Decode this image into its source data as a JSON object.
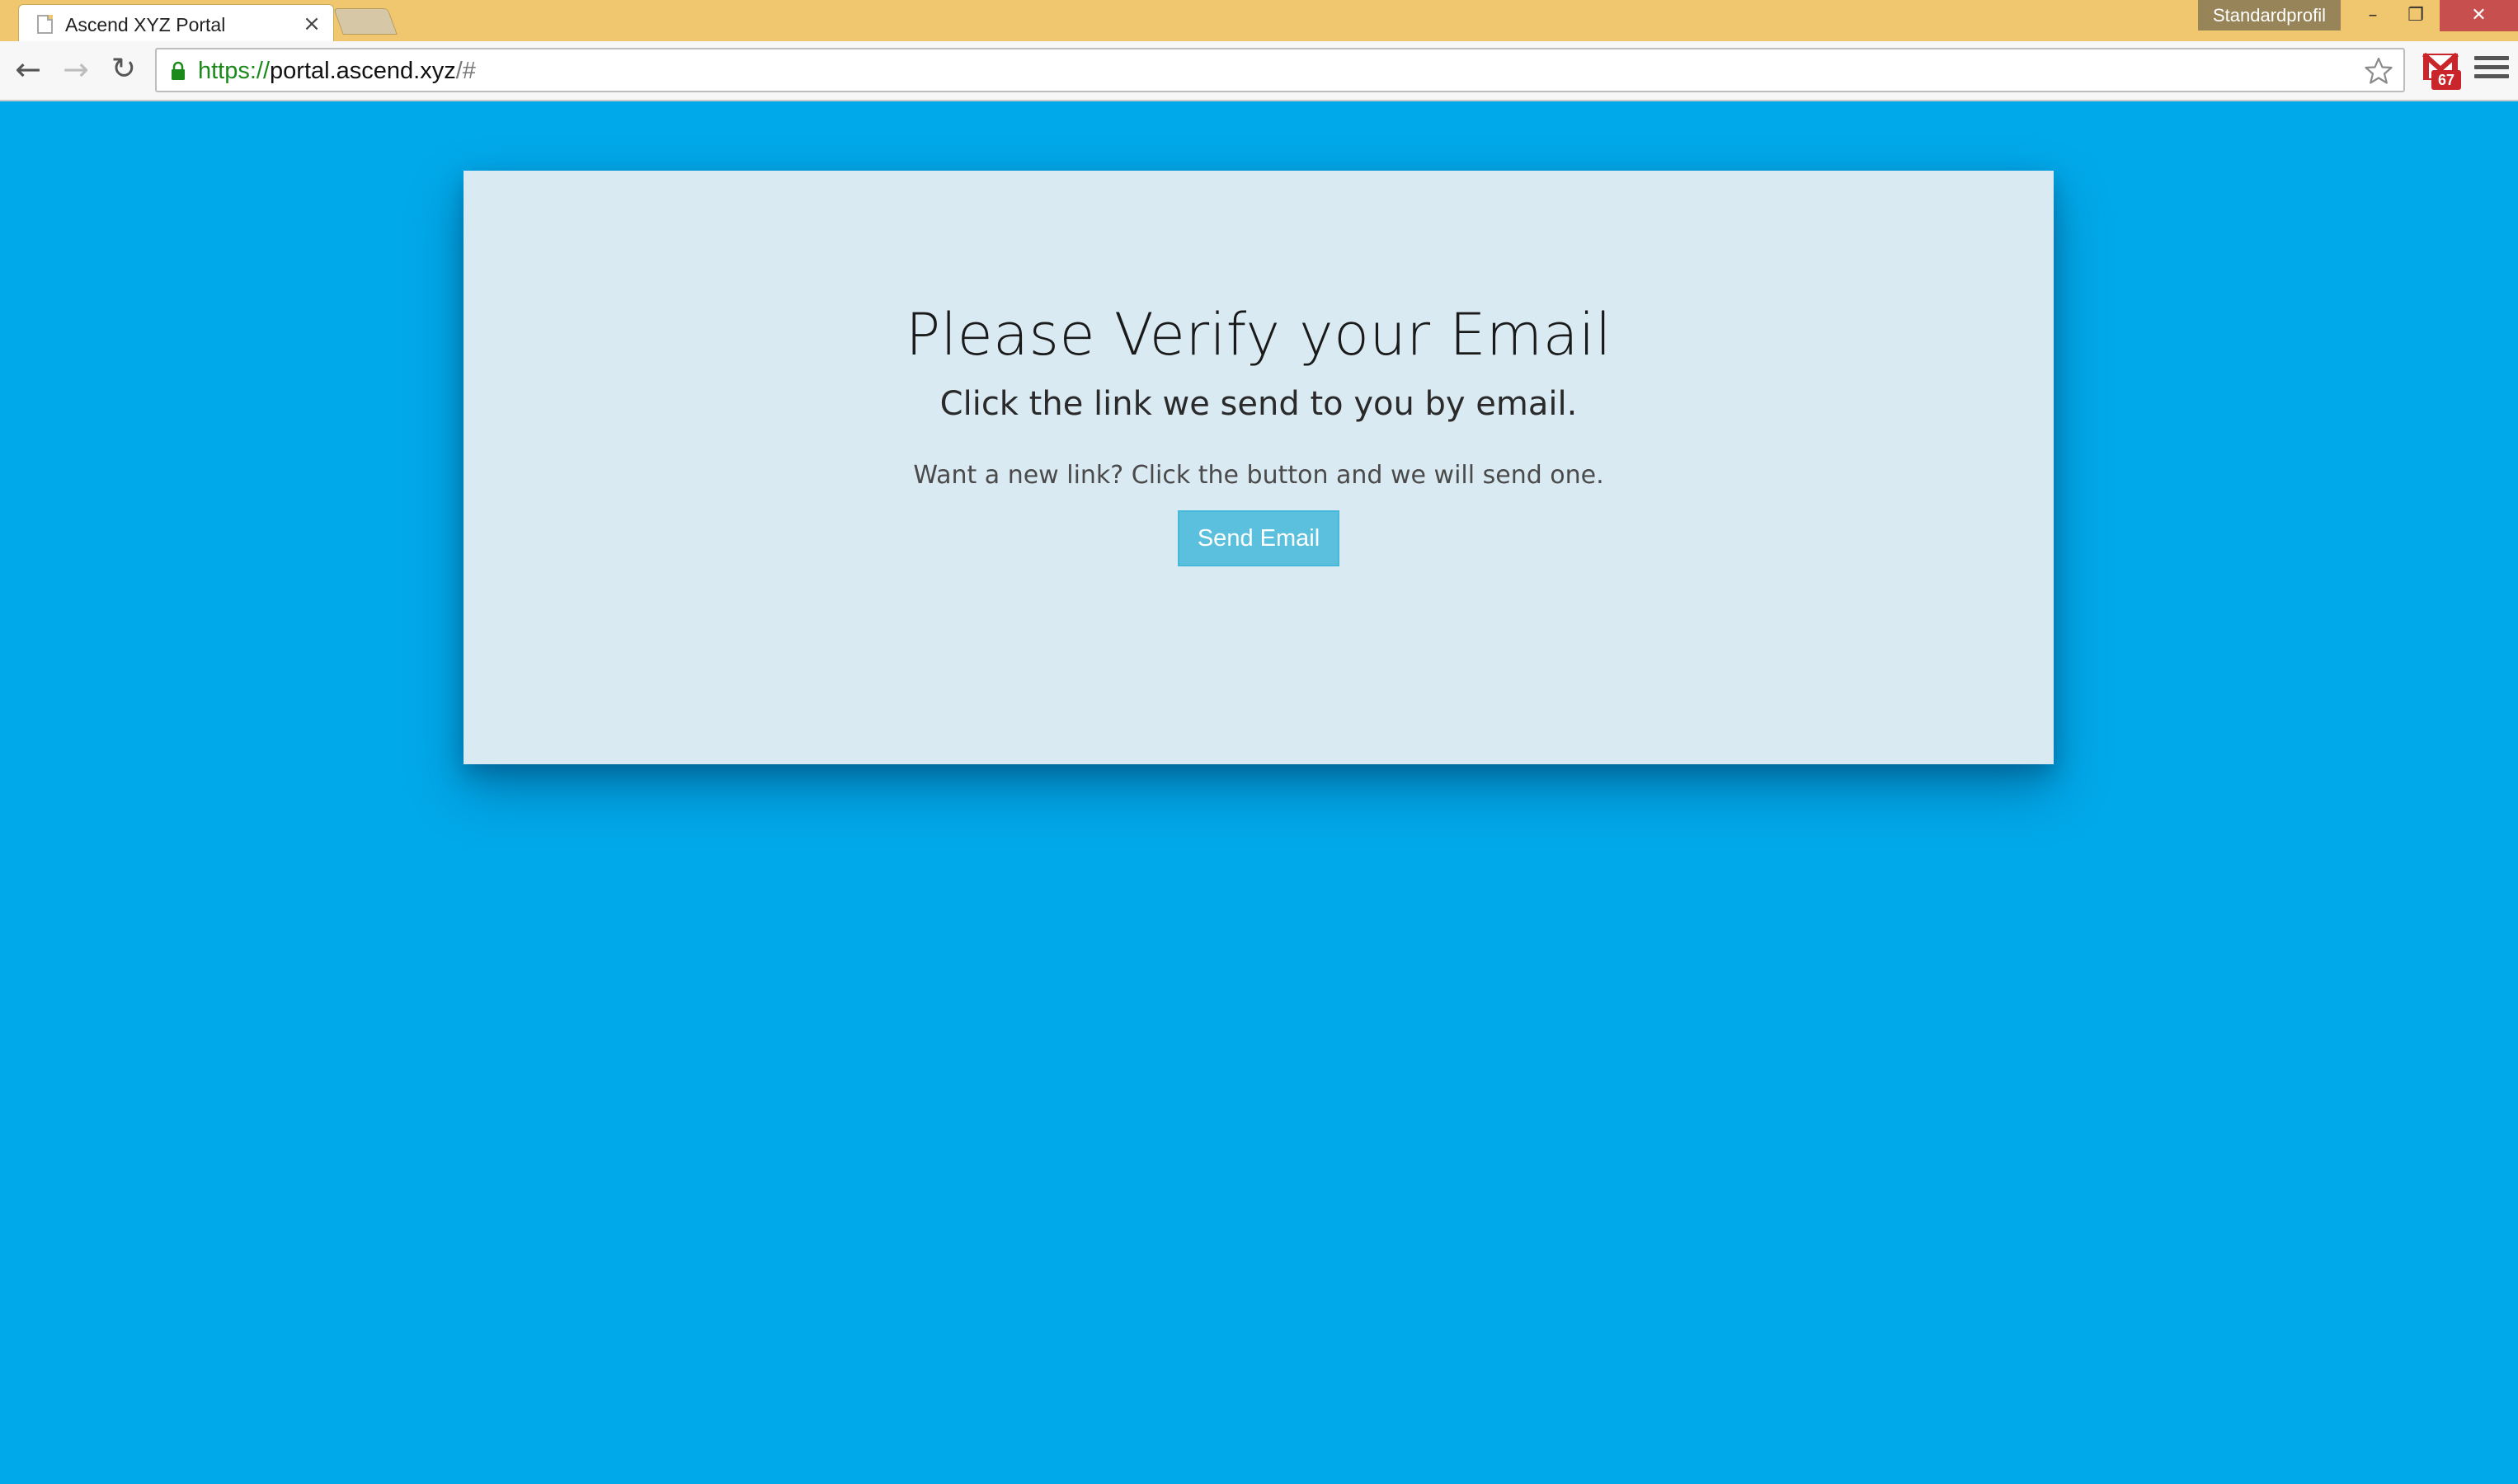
{
  "browser": {
    "tab": {
      "title": "Ascend XYZ Portal",
      "close_glyph": "×",
      "page_icon": "document-icon"
    },
    "profile_label": "Standardprofil",
    "window_controls": {
      "minimize_glyph": "–",
      "restore_glyph": "❐",
      "close_glyph": "✕",
      "close_color": "#c7504f"
    },
    "nav": {
      "back_glyph": "←",
      "forward_glyph": "→",
      "reload_glyph": "↻"
    },
    "address_bar": {
      "scheme": "https://",
      "host": "portal.ascend.xyz",
      "path": "/#",
      "secure_icon": "lock-icon",
      "secure_color": "#1b8a1b"
    },
    "extension": {
      "icon": "gmail-icon",
      "badge_count": "67"
    },
    "menu_icon": "hamburger-menu-icon",
    "titlebar_color": "#f0c76f"
  },
  "page": {
    "background_color": "#00a9ea",
    "card": {
      "background_color": "#daeaf3",
      "heading": "Please Verify your Email",
      "subheading": "Click the link we send to you by email.",
      "prompt": "Want a new link? Click the button and we will send one.",
      "button_label": "Send Email",
      "button_color": "#5bc0de"
    }
  }
}
